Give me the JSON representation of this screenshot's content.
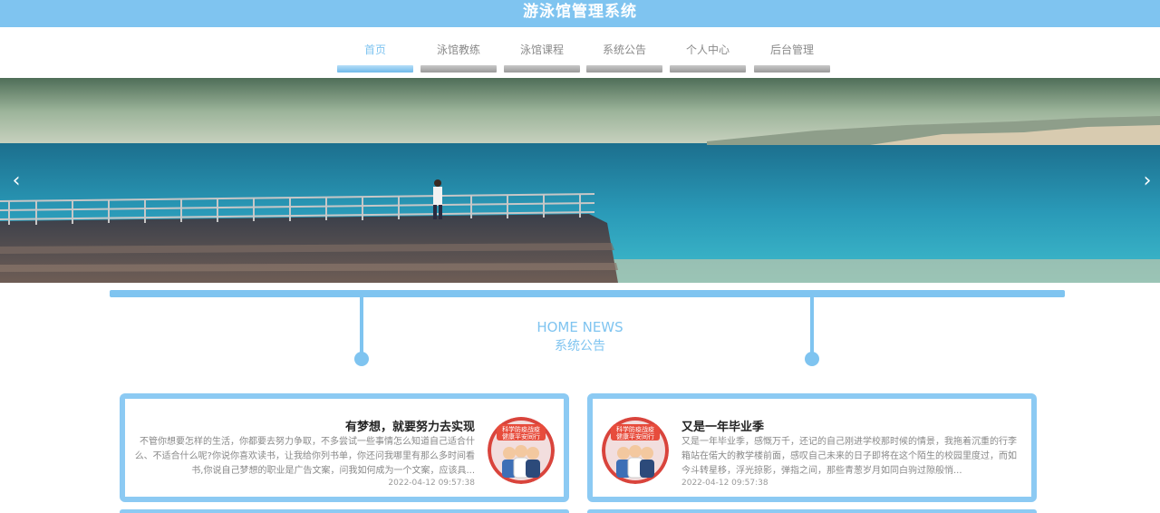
{
  "header": {
    "title": "游泳馆管理系统"
  },
  "nav": {
    "items": [
      {
        "label": "首页",
        "active": true
      },
      {
        "label": "泳馆教练",
        "active": false
      },
      {
        "label": "泳馆课程",
        "active": false
      },
      {
        "label": "系统公告",
        "active": false
      },
      {
        "label": "个人中心",
        "active": false
      },
      {
        "label": "后台管理",
        "active": false
      }
    ]
  },
  "banner": {
    "prev_icon": "chevron-left-icon",
    "next_icon": "chevron-right-icon",
    "prev_glyph": "‹",
    "next_glyph": "›"
  },
  "news": {
    "heading_en": "HOME NEWS",
    "heading_cn": "系统公告",
    "items": [
      {
        "title": "有梦想，就要努力去实现",
        "summary": "不管你想要怎样的生活，你都要去努力争取，不多尝试一些事情怎么知道自己适合什么、不适合什么呢?你说你喜欢读书，让我给你列书单，你还问我哪里有那么多时间看书,你说自己梦想的职业是广告文案，问我如何成为一个文案，应该具...",
        "date": "2022-04-12 09:57:38",
        "thumb_text_1": "科学防疫战疫",
        "thumb_text_2": "健康平安同行"
      },
      {
        "title": "又是一年毕业季",
        "summary": "又是一年毕业季，感慨万千，还记的自己刚进学校那时候的情景，我拖着沉重的行李箱站在偌大的教学楼前面，感叹自己未来的日子即将在这个陌生的校园里度过，而如今斗转星移，浮光掠影，弹指之间，那些青葱岁月如同白驹过隙般悄...",
        "date": "2022-04-12 09:57:38",
        "thumb_text_1": "科学防疫战疫",
        "thumb_text_2": "健康平安同行"
      }
    ]
  },
  "colors": {
    "accent": "#7fc4f0",
    "card_border": "#8ccaf3",
    "nav_inactive": "#8a8a8a"
  }
}
